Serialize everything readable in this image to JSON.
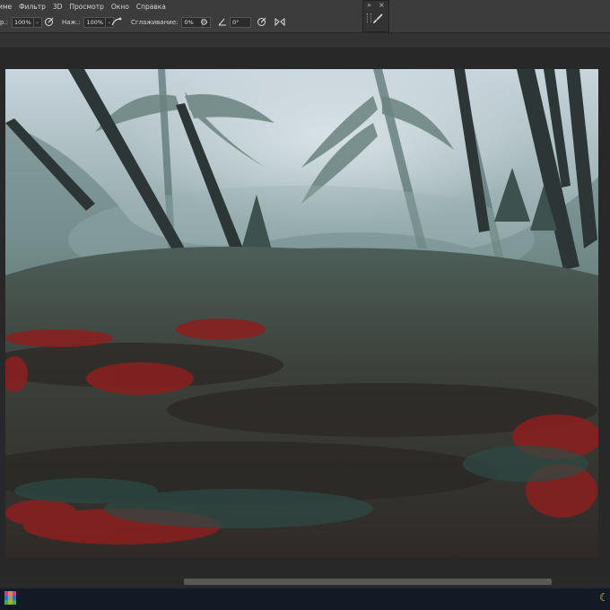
{
  "menu": [
    "име",
    "Фильтр",
    "3D",
    "Просмотр",
    "Окно",
    "Справка"
  ],
  "options": {
    "opacity_label": "р.:",
    "opacity_value": "100%",
    "pressure_label": "Наж.:",
    "pressure_value": "100%",
    "smoothing_label": "Сглаживание:",
    "smoothing_value": "0%",
    "angle_value": "0°"
  },
  "dock": {
    "collapse": "»",
    "close": "×"
  },
  "colors": {
    "accent_sky": "#c5d3dc",
    "bush_red": "#8c1f1f",
    "ui_bg": "#3c3c3c"
  },
  "icons": [
    "pressure-opacity-icon",
    "airbrush-icon",
    "settings-gear-icon",
    "angle-icon",
    "pressure-size-icon",
    "symmetry-icon",
    "brush-icon",
    "winrar-icon",
    "moon-icon"
  ]
}
